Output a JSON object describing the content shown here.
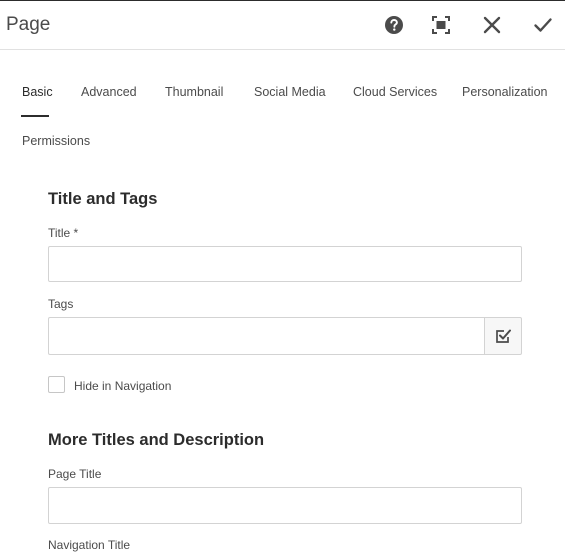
{
  "header": {
    "title": "Page",
    "icons": [
      "help-icon",
      "fullscreen-icon",
      "close-icon",
      "checkmark-icon"
    ]
  },
  "tabs": {
    "items": [
      "Basic",
      "Advanced",
      "Thumbnail",
      "Social Media",
      "Cloud Services",
      "Personalization",
      "Permissions"
    ],
    "active": "Basic"
  },
  "form": {
    "section1_title": "Title and Tags",
    "title_label": "Title *",
    "title_value": "",
    "tags_label": "Tags",
    "tags_value": "",
    "hide_nav_label": "Hide in Navigation",
    "hide_nav_checked": false,
    "section2_title": "More Titles and Description",
    "page_title_label": "Page Title",
    "page_title_value": "",
    "nav_title_label": "Navigation Title"
  },
  "colors": {
    "text_dark": "#2c2c2c",
    "text": "#4b4b4b",
    "border": "#d3d3d3"
  }
}
